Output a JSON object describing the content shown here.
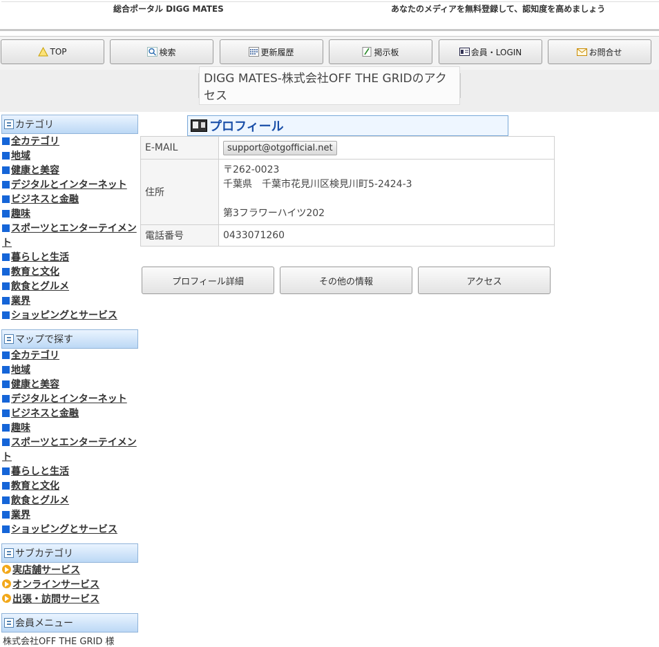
{
  "header": {
    "site_title": "総合ポータル DIGG MATES",
    "tagline": "あなたのメディアを無料登録して、認知度を高めましょう"
  },
  "nav": [
    {
      "label": "TOP",
      "icon": "warning-triangle-icon"
    },
    {
      "label": "検索",
      "icon": "magnifier-icon"
    },
    {
      "label": "更新履歴",
      "icon": "calendar-grid-icon"
    },
    {
      "label": "掲示板",
      "icon": "notepad-pencil-icon"
    },
    {
      "label": "会員・LOGIN",
      "icon": "member-card-icon"
    },
    {
      "label": "お問合せ",
      "icon": "envelope-icon"
    }
  ],
  "page_title": "DIGG MATES-株式会社OFF THE GRIDのアクセス",
  "sidebar": {
    "category": {
      "heading": "カテゴリ",
      "items": [
        "全カテゴリ",
        "地域",
        "健康と美容",
        "デジタルとインターネット",
        "ビジネスと金融",
        "趣味",
        "スポーツとエンターテイメント",
        "暮らしと生活",
        "教育と文化",
        "飲食とグルメ",
        "業界",
        "ショッピングとサービス"
      ]
    },
    "map": {
      "heading": "マップで探す",
      "items": [
        "全カテゴリ",
        "地域",
        "健康と美容",
        "デジタルとインターネット",
        "ビジネスと金融",
        "趣味",
        "スポーツとエンターテイメント",
        "暮らしと生活",
        "教育と文化",
        "飲食とグルメ",
        "業界",
        "ショッピングとサービス"
      ]
    },
    "subcategory": {
      "heading": "サブカテゴリ",
      "items": [
        "実店舗サービス",
        "オンラインサービス",
        "出張・訪問サービス"
      ]
    },
    "member_menu": {
      "heading": "会員メニュー",
      "text": "株式会社OFF THE GRID 様"
    }
  },
  "profile": {
    "heading": "プロフィール",
    "email_label": "E-MAIL",
    "email_value": "support@otgofficial.net",
    "address_label": "住所",
    "address_zip": "〒262-0023",
    "address_line1": "千葉県　千葉市花見川区検見川町5-2424-3",
    "address_line2": "第3フラワーハイツ202",
    "phone_label": "電話番号",
    "phone_value": "0433071260"
  },
  "actions": {
    "profile_detail": "プロフィール詳細",
    "other_info": "その他の情報",
    "access": "アクセス"
  },
  "colors": {
    "bullet": "#1565d8",
    "profile_title": "#1a4fa8",
    "sidebar_head": "#bcd8f5"
  }
}
